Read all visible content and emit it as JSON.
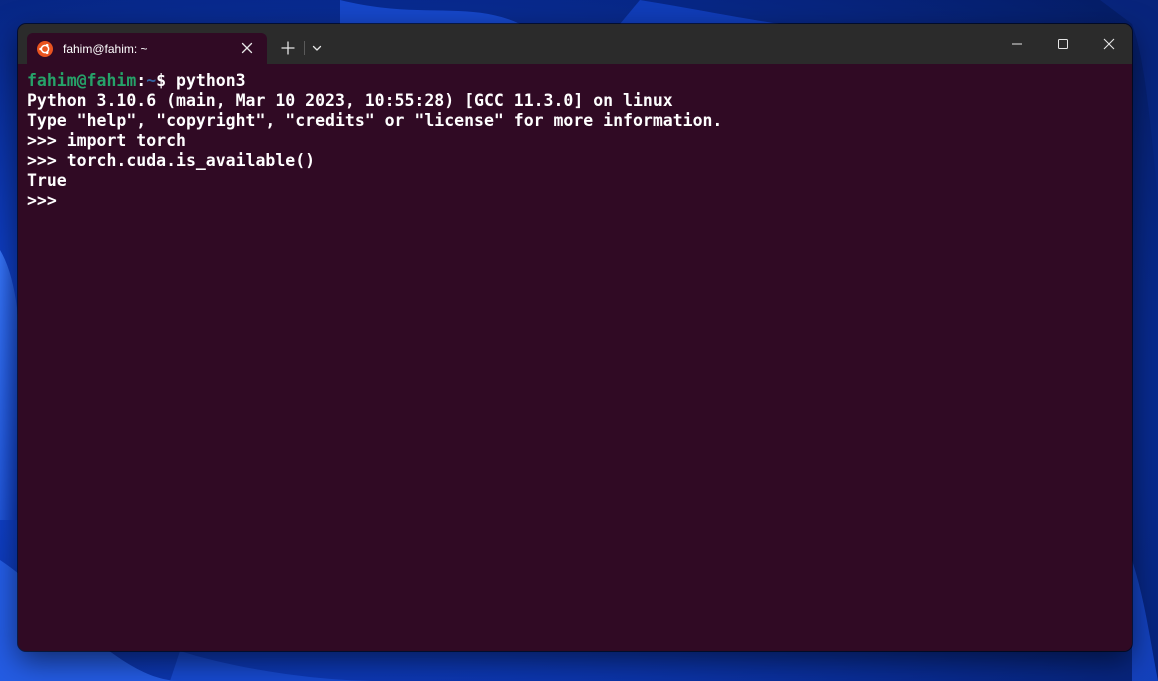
{
  "colors": {
    "terminal_bg": "#300a24",
    "titlebar_bg": "#2b2b2b",
    "prompt_user": "#26a269",
    "prompt_path": "#3465a4",
    "ubuntu_orange": "#e95420"
  },
  "tab": {
    "title": "fahim@fahim: ~",
    "icon": "ubuntu-logo-icon"
  },
  "prompt": {
    "user_host": "fahim@fahim",
    "colon": ":",
    "path": "~",
    "symbol": "$",
    "command": " python3"
  },
  "output": {
    "line1": "Python 3.10.6 (main, Mar 10 2023, 10:55:28) [GCC 11.3.0] on linux",
    "line2": "Type \"help\", \"copyright\", \"credits\" or \"license\" for more information.",
    "line3": ">>> import torch",
    "line4": ">>> torch.cuda.is_available()",
    "line5": "True",
    "line6": ">>>"
  }
}
